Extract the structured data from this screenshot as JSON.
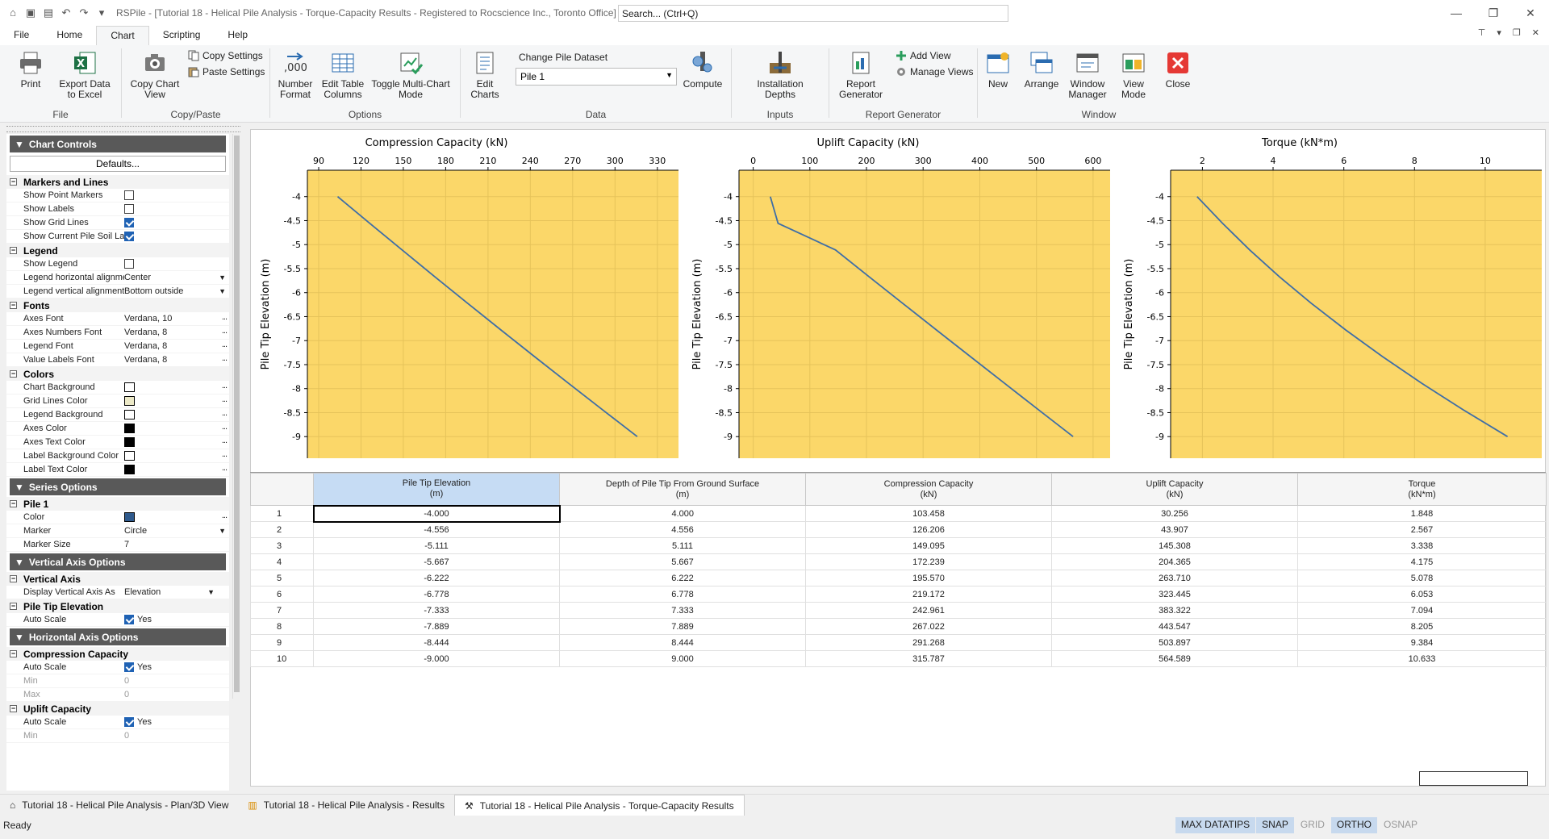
{
  "window": {
    "title": "RSPile - [Tutorial 18 - Helical Pile Analysis - Torque-Capacity Results - Registered to Rocscience Inc., Toronto Office]",
    "search_placeholder": "Search... (Ctrl+Q)"
  },
  "menu_tabs": [
    "File",
    "Home",
    "Chart",
    "Scripting",
    "Help"
  ],
  "active_tab": "Chart",
  "ribbon": {
    "file": {
      "label": "File",
      "print": "Print",
      "export": "Export Data to Excel"
    },
    "copypaste": {
      "label": "Copy/Paste",
      "copy_chart": "Copy Chart View",
      "copy_settings": "Copy Settings",
      "paste_settings": "Paste Settings"
    },
    "options": {
      "label": "Options",
      "number_format": "Number Format",
      "edit_table": "Edit Table Columns",
      "toggle": "Toggle Multi-Chart Mode"
    },
    "data": {
      "label": "Data",
      "edit_charts": "Edit Charts",
      "change_pile_label": "Change Pile Dataset",
      "pile_value": "Pile 1",
      "compute": "Compute"
    },
    "inputs": {
      "label": "Inputs",
      "installation_depths": "Installation Depths"
    },
    "report": {
      "label": "Report Generator",
      "report_generator": "Report Generator",
      "add_view": "Add View",
      "manage_views": "Manage Views"
    },
    "window": {
      "label": "Window",
      "new": "New",
      "arrange": "Arrange",
      "window_manager": "Window Manager",
      "view_mode": "View Mode",
      "close": "Close"
    }
  },
  "panel": {
    "chart_controls": "Chart Controls",
    "defaults": "Defaults...",
    "cat_markers": "Markers and Lines",
    "show_point_markers": "Show Point Markers",
    "show_labels": "Show Labels",
    "show_grid_lines": "Show Grid Lines",
    "show_soil_layers": "Show Current Pile Soil Layers",
    "cat_legend": "Legend",
    "show_legend": "Show Legend",
    "legend_h": "Legend horizontal alignment",
    "legend_h_val": "Center",
    "legend_v": "Legend vertical alignment",
    "legend_v_val": "Bottom outside",
    "cat_fonts": "Fonts",
    "axes_font": "Axes Font",
    "axes_font_val": "Verdana, 10",
    "axes_num_font": "Axes Numbers Font",
    "axes_num_font_val": "Verdana, 8",
    "legend_font": "Legend Font",
    "legend_font_val": "Verdana, 8",
    "value_labels_font": "Value Labels Font",
    "value_labels_font_val": "Verdana, 8",
    "cat_colors": "Colors",
    "chart_bg": "Chart Background",
    "grid_color": "Grid Lines Color",
    "legend_bg": "Legend Background",
    "axes_color": "Axes Color",
    "axes_text_color": "Axes Text Color",
    "label_bg_color": "Label Background Color",
    "label_text_color": "Label Text Color",
    "series_options": "Series Options",
    "cat_pile1": "Pile 1",
    "color": "Color",
    "marker": "Marker",
    "marker_val": "Circle",
    "marker_size": "Marker Size",
    "marker_size_val": "7",
    "vertical_axis_options": "Vertical Axis Options",
    "cat_vertical_axis": "Vertical Axis",
    "display_vertical": "Display Vertical Axis As",
    "display_vertical_val": "Elevation",
    "cat_pile_tip": "Pile Tip Elevation",
    "auto_scale": "Auto Scale",
    "yes": "Yes",
    "horizontal_axis_options": "Horizontal Axis Options",
    "cat_compression": "Compression Capacity",
    "min": "Min",
    "max": "Max",
    "zero": "0",
    "cat_uplift": "Uplift Capacity"
  },
  "colors": {
    "plot_bg": "#fbd769",
    "line": "#3f6ea6",
    "series_swatch": "#2f5a8c",
    "grid_swatch": "#ece9c7"
  },
  "chart_data": [
    {
      "type": "line",
      "title": "Compression Capacity (kN)",
      "ylabel": "Pile Tip Elevation (m)",
      "x_ticks": [
        90,
        120,
        150,
        180,
        210,
        240,
        270,
        300,
        330
      ],
      "y_ticks": [
        -4,
        -4.5,
        -5,
        -5.5,
        -6,
        -6.5,
        -7,
        -7.5,
        -8,
        -8.5,
        -9
      ],
      "xlim": [
        82,
        345
      ],
      "ylim": [
        -9.45,
        -3.45
      ],
      "x": [
        103.458,
        126.206,
        149.095,
        172.239,
        195.57,
        219.172,
        242.961,
        267.022,
        291.268,
        315.787
      ],
      "y": [
        -4.0,
        -4.556,
        -5.111,
        -5.667,
        -6.222,
        -6.778,
        -7.333,
        -7.889,
        -8.444,
        -9.0
      ]
    },
    {
      "type": "line",
      "title": "Uplift Capacity (kN)",
      "ylabel": "Pile Tip Elevation (m)",
      "x_ticks": [
        0,
        100,
        200,
        300,
        400,
        500,
        600
      ],
      "y_ticks": [
        -4,
        -4.5,
        -5,
        -5.5,
        -6,
        -6.5,
        -7,
        -7.5,
        -8,
        -8.5,
        -9
      ],
      "xlim": [
        -25,
        630
      ],
      "ylim": [
        -9.45,
        -3.45
      ],
      "x": [
        30.256,
        43.907,
        145.308,
        204.365,
        263.71,
        323.445,
        383.322,
        443.547,
        503.897,
        564.589
      ],
      "y": [
        -4.0,
        -4.556,
        -5.111,
        -5.667,
        -6.222,
        -6.778,
        -7.333,
        -7.889,
        -8.444,
        -9.0
      ]
    },
    {
      "type": "line",
      "title": "Torque (kN*m)",
      "ylabel": "Pile Tip Elevation (m)",
      "x_ticks": [
        2,
        4,
        6,
        8,
        10
      ],
      "y_ticks": [
        -4,
        -4.5,
        -5,
        -5.5,
        -6,
        -6.5,
        -7,
        -7.5,
        -8,
        -8.5,
        -9
      ],
      "xlim": [
        1.1,
        11.6
      ],
      "ylim": [
        -9.45,
        -3.45
      ],
      "x": [
        1.848,
        2.567,
        3.338,
        4.175,
        5.078,
        6.053,
        7.094,
        8.205,
        9.384,
        10.633
      ],
      "y": [
        -4.0,
        -4.556,
        -5.111,
        -5.667,
        -6.222,
        -6.778,
        -7.333,
        -7.889,
        -8.444,
        -9.0
      ]
    }
  ],
  "table": {
    "headers": [
      {
        "l1": "Pile Tip Elevation",
        "l2": "(m)"
      },
      {
        "l1": "Depth of Pile Tip From Ground Surface",
        "l2": "(m)"
      },
      {
        "l1": "Compression Capacity",
        "l2": "(kN)"
      },
      {
        "l1": "Uplift Capacity",
        "l2": "(kN)"
      },
      {
        "l1": "Torque",
        "l2": "(kN*m)"
      }
    ],
    "rows": [
      [
        "1",
        "-4.000",
        "4.000",
        "103.458",
        "30.256",
        "1.848"
      ],
      [
        "2",
        "-4.556",
        "4.556",
        "126.206",
        "43.907",
        "2.567"
      ],
      [
        "3",
        "-5.111",
        "5.111",
        "149.095",
        "145.308",
        "3.338"
      ],
      [
        "4",
        "-5.667",
        "5.667",
        "172.239",
        "204.365",
        "4.175"
      ],
      [
        "5",
        "-6.222",
        "6.222",
        "195.570",
        "263.710",
        "5.078"
      ],
      [
        "6",
        "-6.778",
        "6.778",
        "219.172",
        "323.445",
        "6.053"
      ],
      [
        "7",
        "-7.333",
        "7.333",
        "242.961",
        "383.322",
        "7.094"
      ],
      [
        "8",
        "-7.889",
        "7.889",
        "267.022",
        "443.547",
        "8.205"
      ],
      [
        "9",
        "-8.444",
        "8.444",
        "291.268",
        "503.897",
        "9.384"
      ],
      [
        "10",
        "-9.000",
        "9.000",
        "315.787",
        "564.589",
        "10.633"
      ]
    ]
  },
  "doc_tabs": [
    "Tutorial 18 - Helical Pile Analysis - Plan/3D View",
    "Tutorial 18 - Helical Pile Analysis - Results",
    "Tutorial 18 - Helical Pile Analysis - Torque-Capacity Results"
  ],
  "status": {
    "text": "Ready",
    "buttons": [
      "MAX DATATIPS",
      "SNAP",
      "GRID",
      "ORTHO",
      "OSNAP"
    ]
  }
}
